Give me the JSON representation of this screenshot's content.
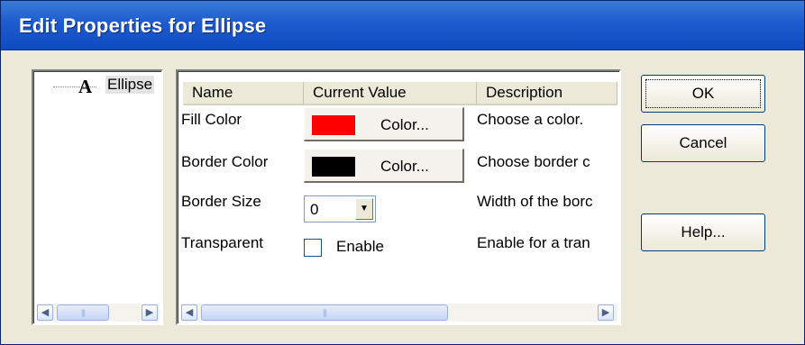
{
  "dialog": {
    "title": "Edit Properties for Ellipse"
  },
  "tree": {
    "items": [
      {
        "icon": "text-A-icon",
        "glyph": "A",
        "label": "Ellipse"
      }
    ]
  },
  "grid": {
    "columns": [
      "Name",
      "Current Value",
      "Description"
    ],
    "rows": [
      {
        "name": "Fill Color",
        "control": "color",
        "swatch_color": "#ff0000",
        "button_label": "Color...",
        "description": "Choose a color."
      },
      {
        "name": "Border Color",
        "control": "color",
        "swatch_color": "#000000",
        "button_label": "Color...",
        "description": "Choose border c"
      },
      {
        "name": "Border Size",
        "control": "select",
        "value": "0",
        "description": "Width of the borc"
      },
      {
        "name": "Transparent",
        "control": "checkbox",
        "checked": false,
        "checkbox_label": "Enable",
        "description": "Enable for a tran"
      }
    ]
  },
  "buttons": {
    "ok": "OK",
    "cancel": "Cancel",
    "help": "Help..."
  },
  "colors": {
    "titlebar": "#0f4bc0",
    "dialog_bg": "#ece9d8"
  }
}
